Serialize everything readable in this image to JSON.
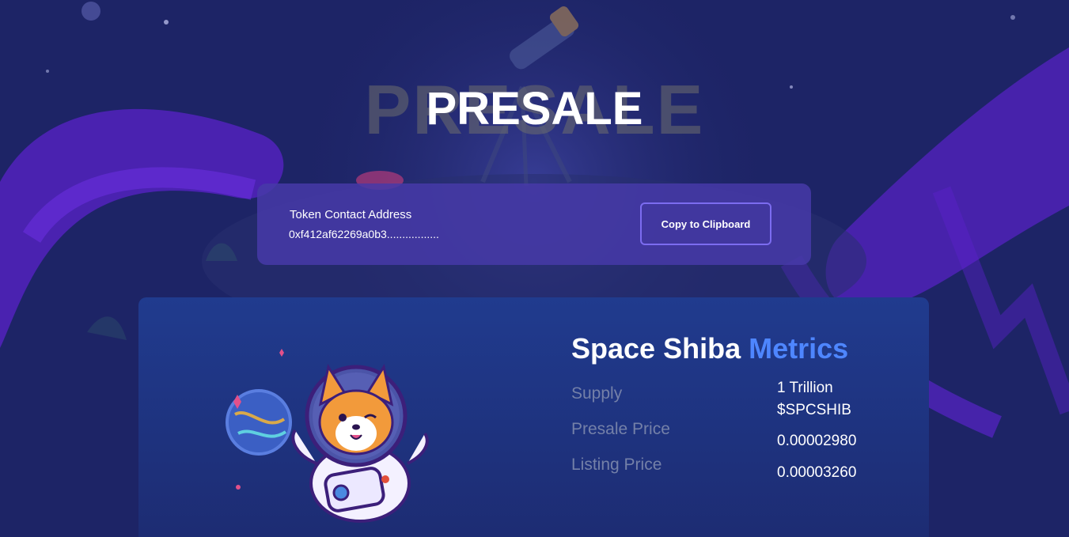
{
  "page": {
    "title_ghost": "PRESALE",
    "title": "PRESALE"
  },
  "token_card": {
    "label": "Token Contact Address",
    "address": "0xf412af62269a0b3.................",
    "copy_button": "Copy to Clipboard"
  },
  "metrics": {
    "title_prefix": "Space Shiba",
    "title_accent": "Metrics",
    "rows": [
      {
        "label": "Supply",
        "value_line1": "1 Trillion",
        "value_line2": "$SPCSHIB"
      },
      {
        "label": "Presale Price",
        "value": "0.00002980"
      },
      {
        "label": "Listing Price",
        "value": "0.00003260"
      }
    ]
  },
  "colors": {
    "background": "#1c2363",
    "card_purple": "#463aa8",
    "accent_blue": "#4e86ff",
    "button_border": "#7c6cf0",
    "muted_label": "#7480a8"
  },
  "icons": [
    "telescope-illustration",
    "astronaut-shiba-mascot",
    "planet-icon",
    "sparkle-icon"
  ]
}
